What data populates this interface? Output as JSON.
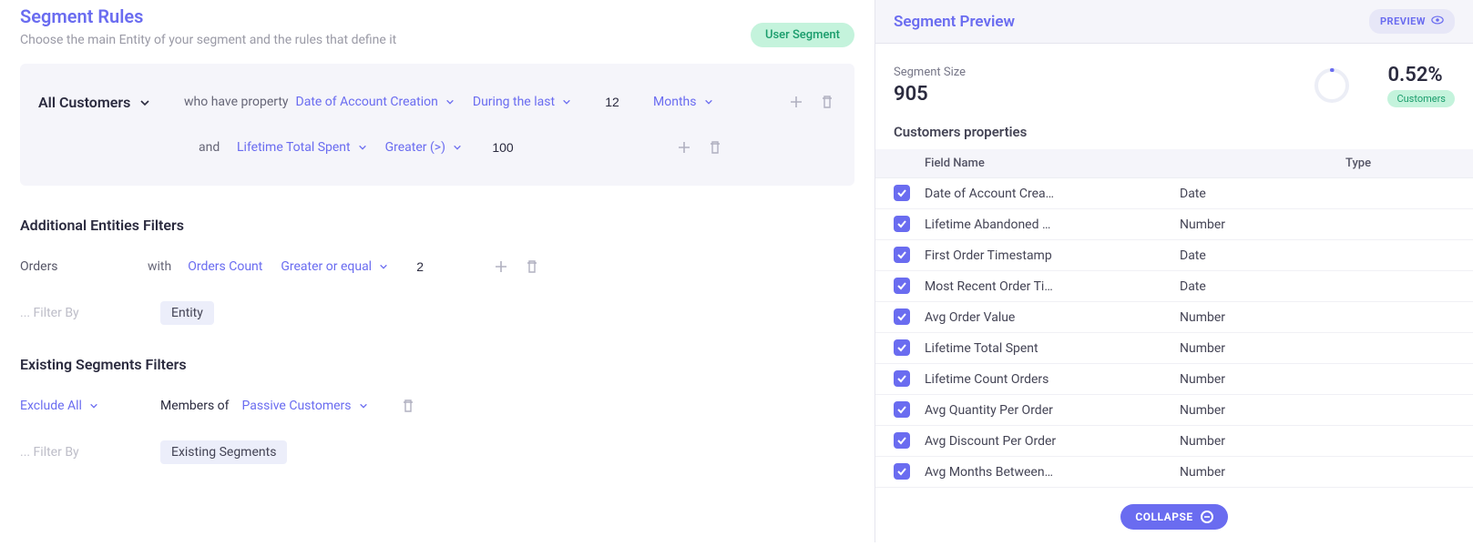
{
  "header": {
    "title": "Segment Rules",
    "subtitle": "Choose the main Entity of your segment and the rules that define it",
    "badge": "User Segment"
  },
  "rules": {
    "entity": "All Customers",
    "row1": {
      "conn": "who have property",
      "property": "Date of Account Creation",
      "operator": "During the last",
      "value": "12",
      "unit": "Months"
    },
    "row2": {
      "conn": "and",
      "property": "Lifetime Total Spent",
      "operator": "Greater (>)",
      "value": "100"
    }
  },
  "additional": {
    "title": "Additional Entities Filters",
    "entity": "Orders",
    "conn": "with",
    "property": "Orders Count",
    "operator": "Greater or equal",
    "value": "2",
    "filter_by_placeholder": "... Filter By",
    "pill": "Entity"
  },
  "existing": {
    "title": "Existing Segments Filters",
    "mode": "Exclude All",
    "members_of": "Members of",
    "segment": "Passive Customers",
    "filter_by_placeholder": "... Filter By",
    "pill": "Existing Segments"
  },
  "preview": {
    "title": "Segment Preview",
    "button": "PREVIEW",
    "size_label": "Segment Size",
    "size_value": "905",
    "pct": "0.52%",
    "pct_label": "Customers",
    "props_title": "Customers properties",
    "cols": {
      "name": "Field Name",
      "type": "Type"
    },
    "rows": [
      {
        "name": "Date of Account Crea…",
        "type": "Date"
      },
      {
        "name": "Lifetime Abandoned …",
        "type": "Number"
      },
      {
        "name": "First Order Timestamp",
        "type": "Date"
      },
      {
        "name": "Most Recent Order Ti…",
        "type": "Date"
      },
      {
        "name": "Avg Order Value",
        "type": "Number"
      },
      {
        "name": "Lifetime Total Spent",
        "type": "Number"
      },
      {
        "name": "Lifetime Count Orders",
        "type": "Number"
      },
      {
        "name": "Avg Quantity Per Order",
        "type": "Number"
      },
      {
        "name": "Avg Discount Per Order",
        "type": "Number"
      },
      {
        "name": "Avg Months Between…",
        "type": "Number"
      }
    ],
    "collapse": "COLLAPSE"
  }
}
